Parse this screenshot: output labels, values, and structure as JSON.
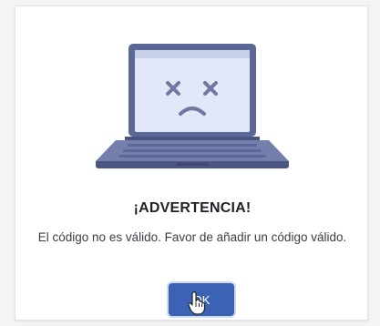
{
  "dialog": {
    "illustration_icon": "broken-laptop-icon",
    "title": "¡ADVERTENCIA!",
    "message": "El código no es válido. Favor de añadir un código válido.",
    "ok_label": "OK"
  },
  "colors": {
    "laptop_body": "#5b6796",
    "laptop_screen": "#e3e8f8",
    "screen_face": "#6f78a0",
    "button_bg": "#3b62b4",
    "title_text": "#1f2127"
  },
  "icons": [
    "broken-laptop-icon",
    "hand-cursor-icon"
  ]
}
